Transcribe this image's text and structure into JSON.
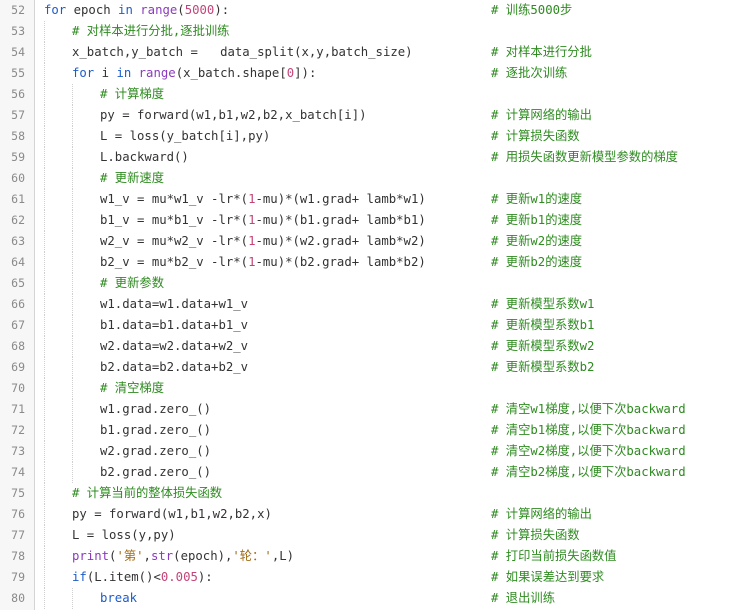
{
  "lines": [
    {
      "n": "52",
      "indent": 0,
      "code": [
        [
          "kw",
          "for"
        ],
        [
          "p",
          " epoch "
        ],
        [
          "kw",
          "in"
        ],
        [
          "p",
          " "
        ],
        [
          "bi",
          "range"
        ],
        [
          "p",
          "("
        ],
        [
          "num",
          "5000"
        ],
        [
          "p",
          "):"
        ]
      ],
      "comment": "# 训练5000步"
    },
    {
      "n": "53",
      "indent": 1,
      "code": [
        [
          "green",
          "# 对样本进行分批,逐批训练"
        ]
      ],
      "comment": ""
    },
    {
      "n": "54",
      "indent": 1,
      "code": [
        [
          "p",
          "x_batch,y_batch =   data_split(x,y,batch_size)"
        ]
      ],
      "comment": "# 对样本进行分批"
    },
    {
      "n": "55",
      "indent": 1,
      "code": [
        [
          "kw",
          "for"
        ],
        [
          "p",
          " i "
        ],
        [
          "kw",
          "in"
        ],
        [
          "p",
          " "
        ],
        [
          "bi",
          "range"
        ],
        [
          "p",
          "(x_batch.shape["
        ],
        [
          "num",
          "0"
        ],
        [
          "p",
          "]):"
        ]
      ],
      "comment": "# 逐批次训练"
    },
    {
      "n": "56",
      "indent": 2,
      "code": [
        [
          "green",
          "# 计算梯度"
        ]
      ],
      "comment": ""
    },
    {
      "n": "57",
      "indent": 2,
      "code": [
        [
          "p",
          "py = forward(w1,b1,w2,b2,x_batch[i])"
        ]
      ],
      "comment": "# 计算网络的输出"
    },
    {
      "n": "58",
      "indent": 2,
      "code": [
        [
          "p",
          "L = loss(y_batch[i],py)"
        ]
      ],
      "comment": "# 计算损失函数"
    },
    {
      "n": "59",
      "indent": 2,
      "code": [
        [
          "p",
          "L.backward()"
        ]
      ],
      "comment": "# 用损失函数更新模型参数的梯度"
    },
    {
      "n": "60",
      "indent": 2,
      "code": [
        [
          "green",
          "# 更新速度"
        ]
      ],
      "comment": ""
    },
    {
      "n": "61",
      "indent": 2,
      "code": [
        [
          "p",
          "w1_v = mu*w1_v -lr*("
        ],
        [
          "num",
          "1"
        ],
        [
          "p",
          "-mu)*(w1.grad+ lamb*w1)"
        ]
      ],
      "comment": "# 更新w1的速度"
    },
    {
      "n": "62",
      "indent": 2,
      "code": [
        [
          "p",
          "b1_v = mu*b1_v -lr*("
        ],
        [
          "num",
          "1"
        ],
        [
          "p",
          "-mu)*(b1.grad+ lamb*b1)"
        ]
      ],
      "comment": "# 更新b1的速度"
    },
    {
      "n": "63",
      "indent": 2,
      "code": [
        [
          "p",
          "w2_v = mu*w2_v -lr*("
        ],
        [
          "num",
          "1"
        ],
        [
          "p",
          "-mu)*(w2.grad+ lamb*w2)"
        ]
      ],
      "comment": "# 更新w2的速度"
    },
    {
      "n": "64",
      "indent": 2,
      "code": [
        [
          "p",
          "b2_v = mu*b2_v -lr*("
        ],
        [
          "num",
          "1"
        ],
        [
          "p",
          "-mu)*(b2.grad+ lamb*b2)"
        ]
      ],
      "comment": "# 更新b2的速度"
    },
    {
      "n": "65",
      "indent": 2,
      "code": [
        [
          "green",
          "# 更新参数"
        ]
      ],
      "comment": ""
    },
    {
      "n": "66",
      "indent": 2,
      "code": [
        [
          "p",
          "w1.data=w1.data+w1_v"
        ]
      ],
      "comment": "# 更新模型系数w1"
    },
    {
      "n": "67",
      "indent": 2,
      "code": [
        [
          "p",
          "b1.data=b1.data+b1_v"
        ]
      ],
      "comment": "# 更新模型系数b1"
    },
    {
      "n": "68",
      "indent": 2,
      "code": [
        [
          "p",
          "w2.data=w2.data+w2_v"
        ]
      ],
      "comment": "# 更新模型系数w2"
    },
    {
      "n": "69",
      "indent": 2,
      "code": [
        [
          "p",
          "b2.data=b2.data+b2_v"
        ]
      ],
      "comment": "# 更新模型系数b2"
    },
    {
      "n": "70",
      "indent": 2,
      "code": [
        [
          "green",
          "# 清空梯度"
        ]
      ],
      "comment": ""
    },
    {
      "n": "71",
      "indent": 2,
      "code": [
        [
          "p",
          "w1.grad.zero_()"
        ]
      ],
      "comment": "# 清空w1梯度,以便下次backward"
    },
    {
      "n": "72",
      "indent": 2,
      "code": [
        [
          "p",
          "b1.grad.zero_()"
        ]
      ],
      "comment": "# 清空b1梯度,以便下次backward"
    },
    {
      "n": "73",
      "indent": 2,
      "code": [
        [
          "p",
          "w2.grad.zero_()"
        ]
      ],
      "comment": "# 清空w2梯度,以便下次backward"
    },
    {
      "n": "74",
      "indent": 2,
      "code": [
        [
          "p",
          "b2.grad.zero_()"
        ]
      ],
      "comment": "# 清空b2梯度,以便下次backward"
    },
    {
      "n": "75",
      "indent": 1,
      "code": [
        [
          "green",
          "# 计算当前的整体损失函数"
        ]
      ],
      "comment": ""
    },
    {
      "n": "76",
      "indent": 1,
      "code": [
        [
          "p",
          "py = forward(w1,b1,w2,b2,x)"
        ]
      ],
      "comment": "# 计算网络的输出"
    },
    {
      "n": "77",
      "indent": 1,
      "code": [
        [
          "p",
          "L = loss(y,py)"
        ]
      ],
      "comment": "# 计算损失函数"
    },
    {
      "n": "78",
      "indent": 1,
      "code": [
        [
          "bi",
          "print"
        ],
        [
          "p",
          "("
        ],
        [
          "str",
          "'第'"
        ],
        [
          "p",
          ","
        ],
        [
          "bi",
          "str"
        ],
        [
          "p",
          "(epoch),"
        ],
        [
          "str",
          "'轮：'"
        ],
        [
          "p",
          ",L)"
        ]
      ],
      "comment": "# 打印当前损失函数值"
    },
    {
      "n": "79",
      "indent": 1,
      "code": [
        [
          "kw",
          "if"
        ],
        [
          "p",
          "(L.item()<"
        ],
        [
          "num",
          "0.005"
        ],
        [
          "p",
          "):"
        ]
      ],
      "comment": "# 如果误差达到要求"
    },
    {
      "n": "80",
      "indent": 2,
      "code": [
        [
          "kw",
          "break"
        ]
      ],
      "comment": "# 退出训练"
    }
  ]
}
